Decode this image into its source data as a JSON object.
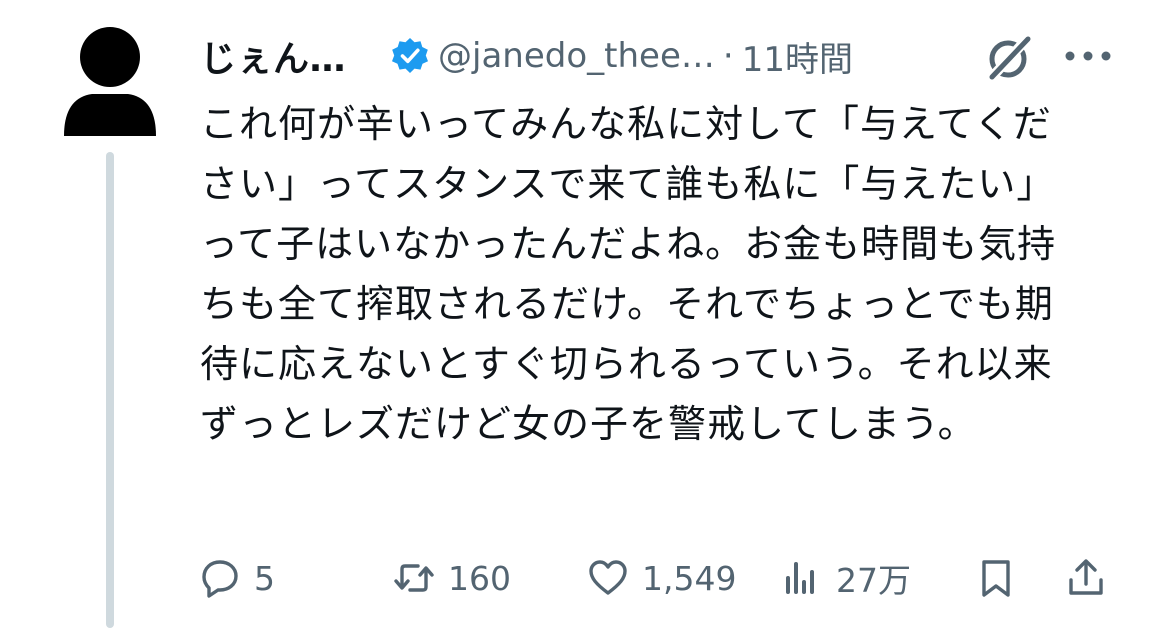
{
  "author": {
    "display_name": "じぇん…",
    "handle": "@janedo_thee…",
    "separator": "·",
    "timestamp": "11時間",
    "verified": true,
    "verified_color": "#1d9bf0"
  },
  "tweet": {
    "text": "これ何が辛いってみんな私に対して「与えてください」ってスタンスで来て誰も私に「与えたい」って子はいなかったんだよね。お金も時間も気持ちも全て搾取されるだけ。それでちょっとでも期待に応えないとすぐ切られるっていう。それ以来ずっとレズだけど女の子を警戒してしまう。"
  },
  "actions": {
    "replies": "5",
    "reposts": "160",
    "likes": "1,549",
    "views": "27万"
  },
  "icons": {
    "avatar": "default-profile-icon",
    "verified": "verified-badge-icon",
    "grok": "grok-icon",
    "more": "more-icon",
    "reply": "reply-icon",
    "repost": "repost-icon",
    "like": "like-icon",
    "views": "views-icon",
    "bookmark": "bookmark-icon",
    "share": "share-icon"
  },
  "colors": {
    "text": "#0f1419",
    "secondary_text": "#536471",
    "thread_line": "#cfd9de"
  }
}
